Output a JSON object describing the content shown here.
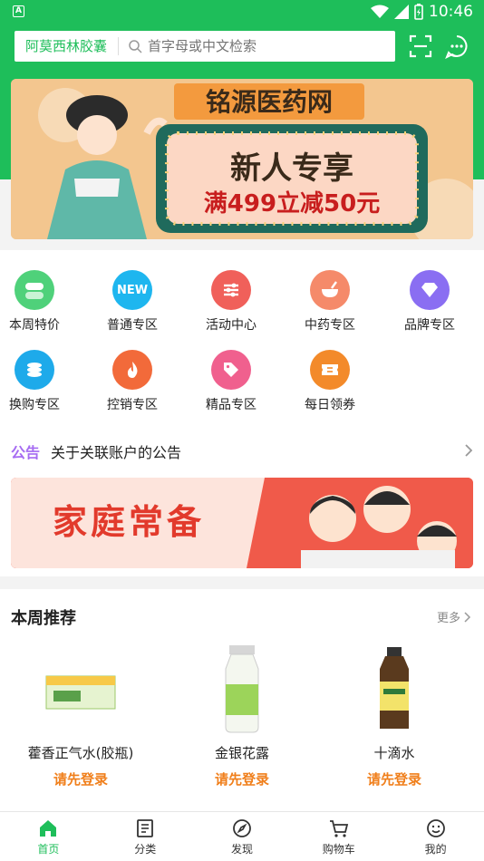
{
  "status_bar": {
    "time": "10:46"
  },
  "search": {
    "tag": "阿莫西林胶囊",
    "placeholder": "首字母或中文检索"
  },
  "banner": {
    "line1": "铭源医药网",
    "line2": "新人专享",
    "line3": "满499立减50元"
  },
  "categories": [
    {
      "label": "本周特价",
      "icon": "pill-icon",
      "color": "#4fd17a"
    },
    {
      "label": "普通专区",
      "icon": "new-icon",
      "color": "#1eb6ef"
    },
    {
      "label": "活动中心",
      "icon": "sliders-icon",
      "color": "#f0605a"
    },
    {
      "label": "中药专区",
      "icon": "mortar-icon",
      "color": "#f58a6a"
    },
    {
      "label": "品牌专区",
      "icon": "diamond-icon",
      "color": "#8a6ef2"
    },
    {
      "label": "换购专区",
      "icon": "coins-icon",
      "color": "#1eaaea"
    },
    {
      "label": "控销专区",
      "icon": "flame-icon",
      "color": "#f26a3a"
    },
    {
      "label": "精品专区",
      "icon": "tag-icon",
      "color": "#f0608e"
    },
    {
      "label": "每日领券",
      "icon": "coupon-icon",
      "color": "#f38a2a"
    }
  ],
  "notice": {
    "tag": "公告",
    "text": "关于关联账户的公告"
  },
  "promo": {
    "text": "家庭常备"
  },
  "weekly": {
    "title": "本周推荐",
    "more": "更多",
    "products": [
      {
        "name": "藿香正气水(胶瓶)",
        "price": "请先登录"
      },
      {
        "name": "金银花露",
        "price": "请先登录"
      },
      {
        "name": "十滴水",
        "price": "请先登录"
      }
    ]
  },
  "tabs": [
    {
      "label": "首页",
      "icon": "home-icon"
    },
    {
      "label": "分类",
      "icon": "list-icon"
    },
    {
      "label": "发现",
      "icon": "compass-icon"
    },
    {
      "label": "购物车",
      "icon": "cart-icon"
    },
    {
      "label": "我的",
      "icon": "smile-icon"
    }
  ],
  "colors": {
    "brand": "#1ebe5a",
    "price": "#f07f1b",
    "notice": "#a66cf2"
  }
}
